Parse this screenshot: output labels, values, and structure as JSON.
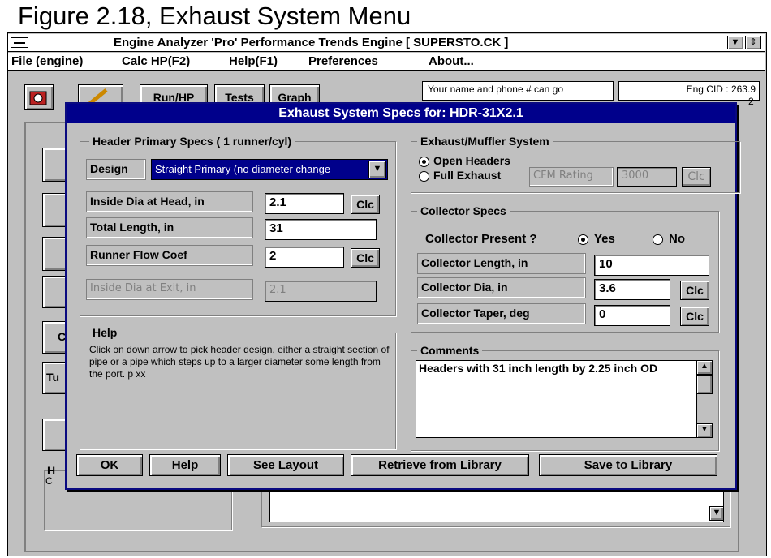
{
  "caption": "Figure 2.18, Exhaust System Menu",
  "app": {
    "title": "Engine Analyzer 'Pro'  Performance Trends   Engine [ SUPERSTO.CK ]"
  },
  "menu": {
    "file": "File (engine)",
    "calc": "Calc HP(F2)",
    "help": "Help(F1)",
    "prefs": "Preferences",
    "about": "About..."
  },
  "toolbar": {
    "run_label": "Run/HP",
    "tests_label": "Tests",
    "graph_label": "Graph",
    "name_text": "Your name and phone # can go",
    "cid_text": "Eng CID : 263.9",
    "cid_tail": "2"
  },
  "background": {
    "left_label_h": "H",
    "left_label_c": "C",
    "left_btn_5": "C",
    "left_btn_6": "Tu"
  },
  "dialog": {
    "title": "Exhaust System Specs for: HDR-31X2.1",
    "header": {
      "group_title": "Header Primary Specs ( 1 runner/cyl)",
      "design_label": "Design",
      "design_value": "Straight Primary (no diameter change",
      "inside_dia_label": "Inside Dia at Head, in",
      "inside_dia_value": "2.1",
      "total_length_label": "Total Length, in",
      "total_length_value": "31",
      "flow_coef_label": "Runner Flow Coef",
      "flow_coef_value": "2",
      "exit_dia_label": "Inside Dia at Exit, in",
      "exit_dia_value": "2.1",
      "clc": "Clc"
    },
    "help": {
      "group_title": "Help",
      "text": "Click on down arrow to pick header design, either a straight section of pipe or a pipe which steps up to a larger diameter some length from the port.  p xx"
    },
    "exhaust": {
      "group_title": "Exhaust/Muffler System",
      "open_label": "Open Headers",
      "full_label": "Full Exhaust",
      "cfm_label": "CFM Rating",
      "cfm_value": "3000",
      "clc": "Clc"
    },
    "collector": {
      "group_title": "Collector Specs",
      "present_label": "Collector Present ?",
      "yes_label": "Yes",
      "no_label": "No",
      "length_label": "Collector Length, in",
      "length_value": "10",
      "dia_label": "Collector Dia, in",
      "dia_value": "3.6",
      "taper_label": "Collector Taper, deg",
      "taper_value": "0",
      "clc": "Clc"
    },
    "comments": {
      "group_title": "Comments",
      "text": "Headers with 31 inch length by 2.25 inch OD"
    },
    "buttons": {
      "ok": "OK",
      "help": "Help",
      "layout": "See Layout",
      "retrieve": "Retrieve from Library",
      "save": "Save to Library"
    }
  }
}
